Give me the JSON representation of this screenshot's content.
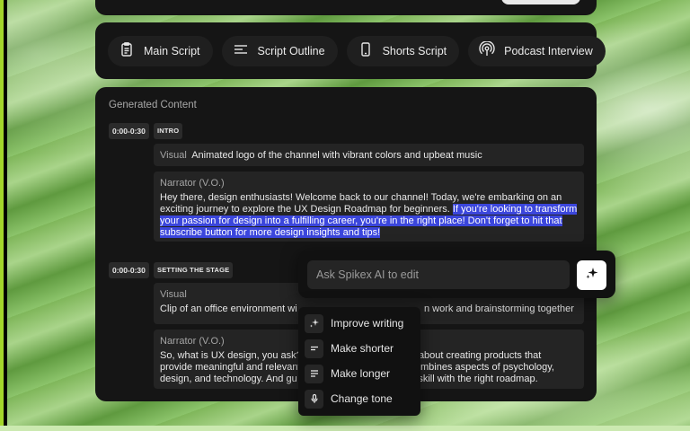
{
  "tabs": [
    {
      "label": "Main Script",
      "icon": "clipboard-icon"
    },
    {
      "label": "Script Outline",
      "icon": "outline-icon"
    },
    {
      "label": "Shorts Script",
      "icon": "phone-icon"
    },
    {
      "label": "Podcast Interview",
      "icon": "podcast-icon"
    }
  ],
  "content": {
    "title": "Generated Content",
    "sections": [
      {
        "time": "0:00-0:30",
        "tag": "INTRO",
        "visual_label": "Visual",
        "visual_text": "Animated logo of the channel with vibrant colors and upbeat music",
        "narrator_label": "Narrator (V.O.)",
        "narrator_text_plain": "Hey there, design enthusiasts! Welcome back to our channel! Today, we're embarking on an exciting journey to explore the UX Design Roadmap for beginners. ",
        "narrator_text_selected": "If you're looking to transform your passion for design into a fulfilling career, you're in the right place! Don't forget to hit that subscribe button for more design insights and tips!"
      },
      {
        "time": "0:00-0:30",
        "tag": "SETTING THE STAGE",
        "visual_label": "Visual",
        "visual_text": "Clip of an office environment wi",
        "visual_text_tail": "n work and brainstorming together",
        "narrator_label": "Narrator (V.O.)",
        "narrator_line1": "So, what is UX design, you ask?",
        "narrator_line1_tail": "ll about creating products that",
        "narrator_line2": "provide meaningful and relevant",
        "narrator_line2_tail": "mbines aspects of psychology,",
        "narrator_line3": "design, and technology. And gu",
        "narrator_line3_tail": "n this skill with the right roadmap."
      }
    ]
  },
  "ai_edit": {
    "placeholder": "Ask Spikex AI to edit",
    "submit_icon": "sparkle-icon",
    "menu": [
      {
        "label": "Improve writing",
        "icon": "sparkle-icon"
      },
      {
        "label": "Make shorter",
        "icon": "short-lines-icon"
      },
      {
        "label": "Make longer",
        "icon": "long-lines-icon"
      },
      {
        "label": "Change tone",
        "icon": "microphone-icon"
      }
    ]
  },
  "colors": {
    "selection": "#3b46dc",
    "panel": "#151515",
    "block": "#242424"
  }
}
